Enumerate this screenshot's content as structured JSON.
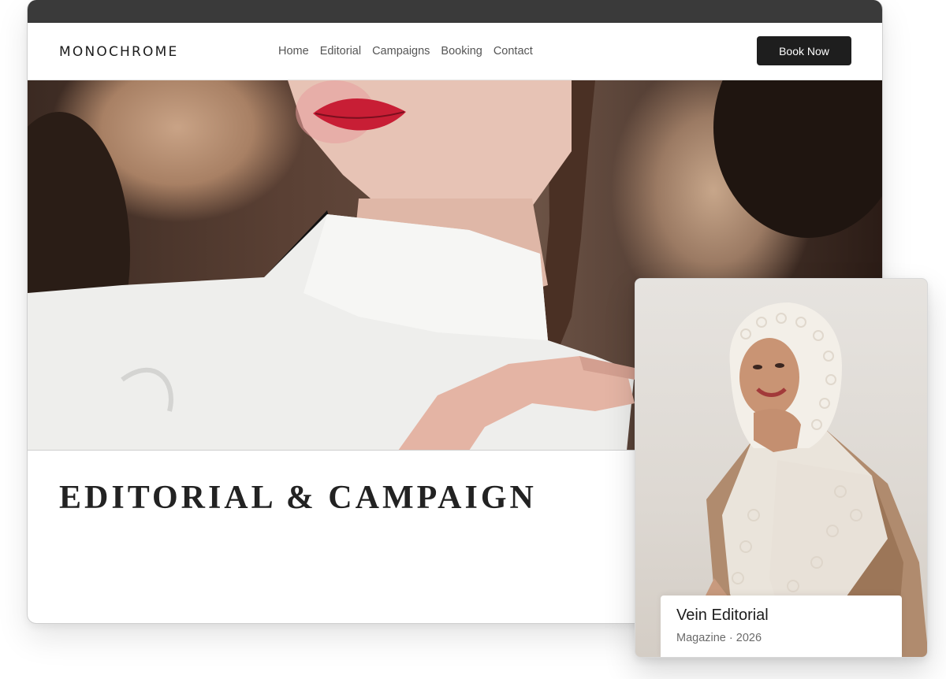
{
  "brand": {
    "name": "MONOCHROME"
  },
  "nav": {
    "items": [
      {
        "label": "Home"
      },
      {
        "label": "Editorial"
      },
      {
        "label": "Campaigns"
      },
      {
        "label": "Booking"
      },
      {
        "label": "Contact"
      }
    ],
    "cta_label": "Book Now"
  },
  "hero": {
    "image": "model-red-lips-white-collar-photo"
  },
  "section": {
    "title": "EDITORIAL & CAMPAIGN"
  },
  "card": {
    "image": "model-white-knit-hood-photo",
    "title": "Vein Editorial",
    "meta": "Magazine · 2026"
  },
  "colors": {
    "titlebar": "#3a3a3a",
    "button_bg": "#1e1e1e",
    "text_dark": "#1c1c1c",
    "text_muted": "#6a6a6a"
  }
}
